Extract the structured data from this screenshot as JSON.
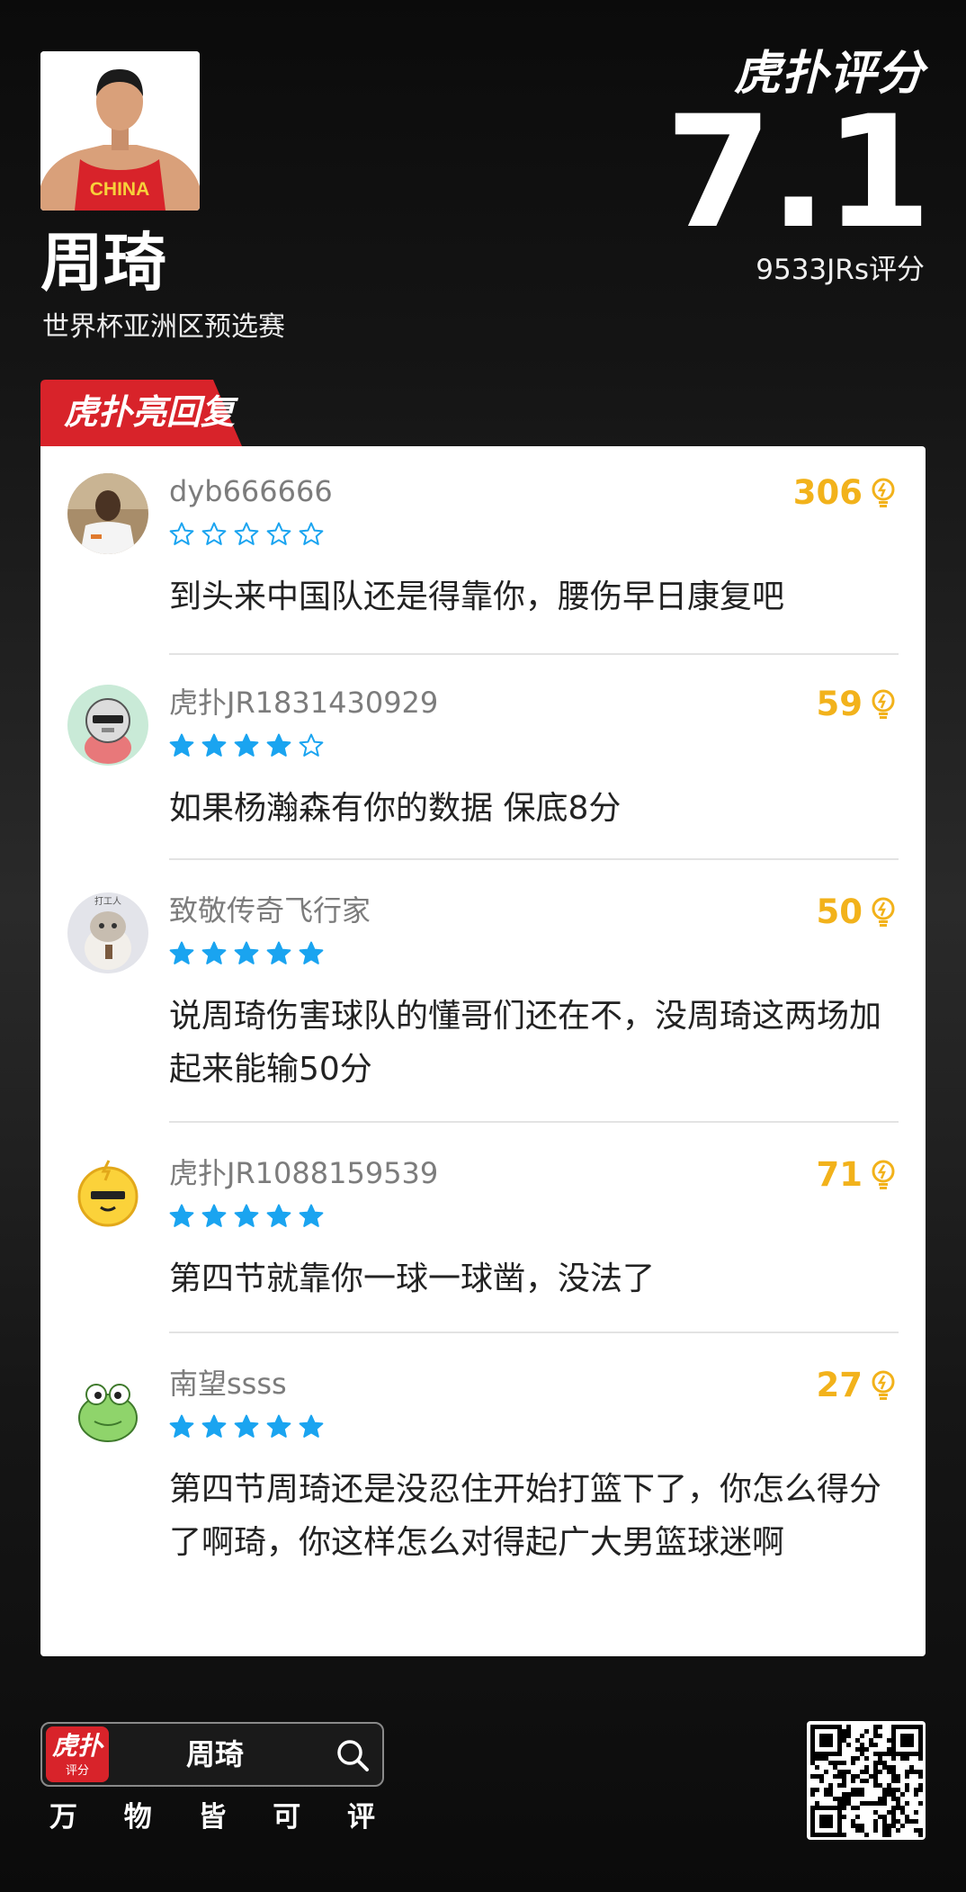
{
  "player": {
    "name": "周琦",
    "event": "世界杯亚洲区预选赛",
    "jersey_text": "CHINA"
  },
  "rating": {
    "brand": "虎扑评分",
    "score": "7.1",
    "count_text": "9533JRs评分"
  },
  "section": {
    "tag": "虎扑亮回复"
  },
  "comments": [
    {
      "user": "dyb666666",
      "stars": 0,
      "likes": "306",
      "text": "到头来中国队还是得靠你，腰伤早日康复吧"
    },
    {
      "user": "虎扑JR1831430929",
      "stars": 4,
      "likes": "59",
      "text": "如果杨瀚森有你的数据 保底8分"
    },
    {
      "user": "致敬传奇飞行家",
      "stars": 5,
      "likes": "50",
      "text": "说周琦伤害球队的懂哥们还在不，没周琦这两场加起来能输50分",
      "avatar_text": "打工人"
    },
    {
      "user": "虎扑JR1088159539",
      "stars": 5,
      "likes": "71",
      "text": "第四节就靠你一球一球凿，没法了"
    },
    {
      "user": "南望ssss",
      "stars": 5,
      "likes": "27",
      "text": "第四节周琦还是没忍住开始打篮下了，你怎么得分了啊琦，你这样怎么对得起广大男篮球迷啊"
    }
  ],
  "footer": {
    "app_icon_top": "虎扑",
    "app_icon_bottom": "评分",
    "search_term": "周琦",
    "slogan": [
      "万",
      "物",
      "皆",
      "可",
      "评"
    ]
  },
  "colors": {
    "accent_red": "#d8232a",
    "star_blue": "#1aa4f0",
    "likes_gold": "#f2b21b"
  }
}
